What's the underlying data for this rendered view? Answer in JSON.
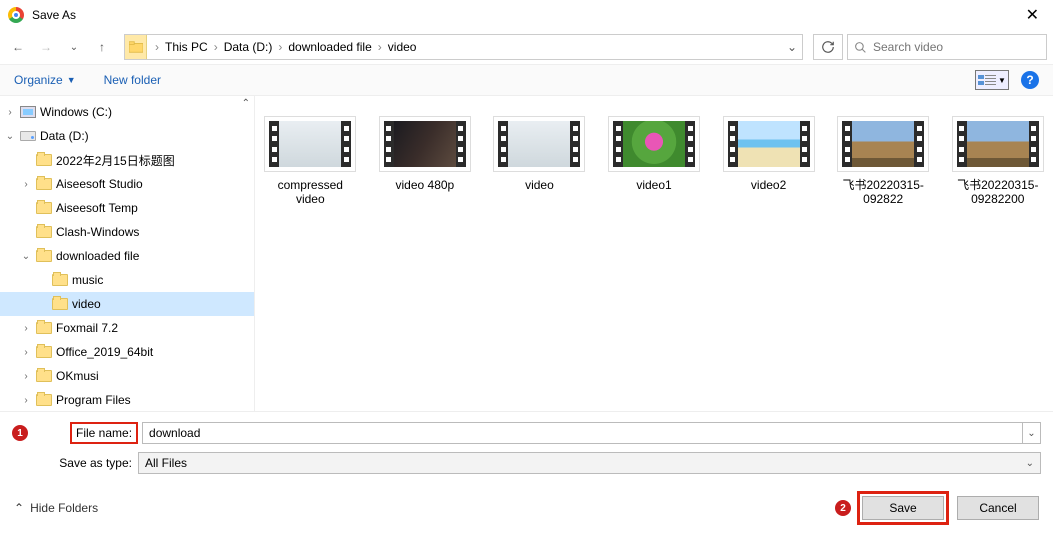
{
  "title": "Save As",
  "breadcrumbs": [
    "This PC",
    "Data (D:)",
    "downloaded file",
    "video"
  ],
  "search_placeholder": "Search video",
  "toolbar": {
    "organize": "Organize",
    "new_folder": "New folder"
  },
  "tree": [
    {
      "label": "Windows (C:)",
      "icon": "mon",
      "indent": 0,
      "expander": "›"
    },
    {
      "label": "Data (D:)",
      "icon": "drive",
      "indent": 0,
      "expander": "⌄"
    },
    {
      "label": "2022年2月15日标题图",
      "icon": "folder",
      "indent": 1,
      "expander": ""
    },
    {
      "label": "Aiseesoft Studio",
      "icon": "folder",
      "indent": 1,
      "expander": "›"
    },
    {
      "label": "Aiseesoft Temp",
      "icon": "folder",
      "indent": 1,
      "expander": ""
    },
    {
      "label": "Clash-Windows",
      "icon": "folder",
      "indent": 1,
      "expander": ""
    },
    {
      "label": "downloaded file",
      "icon": "folder",
      "indent": 1,
      "expander": "⌄"
    },
    {
      "label": "music",
      "icon": "folder",
      "indent": 2,
      "expander": ""
    },
    {
      "label": "video",
      "icon": "folder",
      "indent": 2,
      "expander": "",
      "selected": true
    },
    {
      "label": "Foxmail 7.2",
      "icon": "folder",
      "indent": 1,
      "expander": "›"
    },
    {
      "label": "Office_2019_64bit",
      "icon": "folder",
      "indent": 1,
      "expander": "›"
    },
    {
      "label": "OKmusi",
      "icon": "folder",
      "indent": 1,
      "expander": "›"
    },
    {
      "label": "Program Files",
      "icon": "folder",
      "indent": 1,
      "expander": "›"
    }
  ],
  "files": [
    {
      "name": "compressed video",
      "bg": "linear-gradient(#e9eef2,#cfd8dd)"
    },
    {
      "name": "video 480p",
      "bg": "linear-gradient(120deg,#1b1b20,#3a2d2a 50%,#5d4b3f)"
    },
    {
      "name": "video",
      "bg": "linear-gradient(#e9eef2,#cfd8dd)"
    },
    {
      "name": "video1",
      "bg": "radial-gradient(circle at 50% 45%,#e956b6 0 22%,#56a63e 23% 55%,#3f8a2e 56% 100%)"
    },
    {
      "name": "video2",
      "bg": "linear-gradient(180deg,#bfe3ff 0 40%,#6ec2ef 40% 58%,#efe2b4 58% 100%)"
    },
    {
      "name": "飞书20220315-092822",
      "bg": "linear-gradient(180deg,#8fb6df 0 45%,#a88452 45% 80%,#6e5836 80% 100%)"
    },
    {
      "name": "飞书20220315-09282200",
      "bg": "linear-gradient(180deg,#8fb6df 0 45%,#a88452 45% 80%,#6e5836 80% 100%)"
    }
  ],
  "filename_label": "File name:",
  "filename_value": "download",
  "type_label": "Save as type:",
  "type_value": "All Files",
  "footer": {
    "hide": "Hide Folders",
    "save": "Save",
    "cancel": "Cancel"
  },
  "markers": {
    "one": "1",
    "two": "2"
  }
}
